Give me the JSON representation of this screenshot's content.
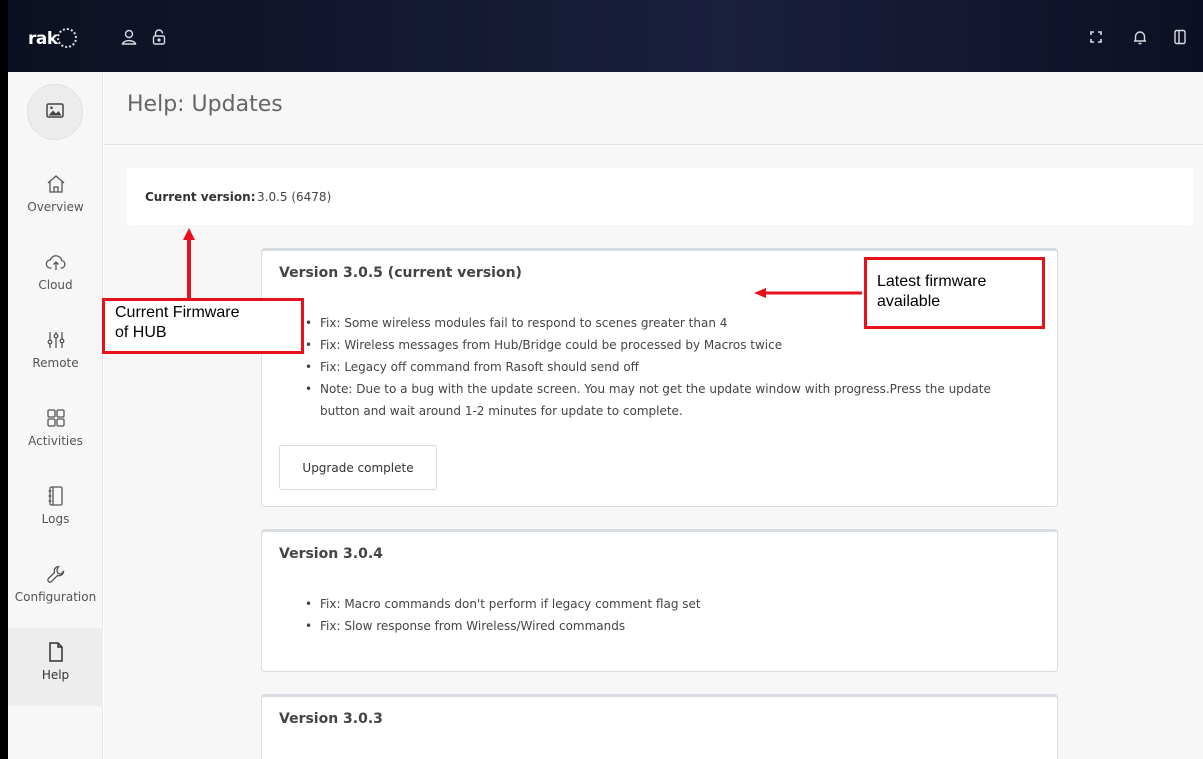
{
  "app": {
    "logo_text": "rak",
    "logo_mark": "gear-dots-logo"
  },
  "topbar": {
    "icons": [
      "user-icon",
      "lock-icon",
      "fullscreen-icon",
      "bell-icon",
      "sidebar-toggle-icon"
    ]
  },
  "sidebar": {
    "avatar_icon": "image-icon",
    "items": [
      {
        "label": "Overview",
        "icon": "home-icon"
      },
      {
        "label": "Cloud",
        "icon": "cloud-upload-icon"
      },
      {
        "label": "Remote",
        "icon": "sliders-icon"
      },
      {
        "label": "Activities",
        "icon": "grid-icon"
      },
      {
        "label": "Logs",
        "icon": "notebook-icon"
      },
      {
        "label": "Configuration",
        "icon": "wrench-icon"
      },
      {
        "label": "Help",
        "icon": "document-icon"
      }
    ],
    "active": "Help"
  },
  "header": {
    "title": "Help: Updates"
  },
  "current_version": {
    "label": "Current version:",
    "value": "3.0.5 (6478)"
  },
  "versions": [
    {
      "title": "Version 3.0.5 (current version)",
      "notes": [
        "Fix: Some wireless modules fail to respond to scenes greater than 4",
        "Fix: Wireless messages from Hub/Bridge could be processed by Macros twice",
        "Fix: Legacy off command from Rasoft should send off",
        "Note: Due to a bug with the update screen. You may not get the update window with progress.Press the update",
        "button and wait around 1-2 minutes for update to complete."
      ],
      "button_label": "Upgrade complete"
    },
    {
      "title": "Version 3.0.4",
      "notes": [
        "Fix: Macro commands don't perform if legacy comment flag set",
        "Fix: Slow response from Wireless/Wired commands"
      ]
    },
    {
      "title": "Version 3.0.3",
      "notes": []
    }
  ],
  "annotations": {
    "current_firmware": {
      "line1": "Current Firmware",
      "line2": "of HUB"
    },
    "latest_firmware": {
      "line1": "Latest firmware",
      "line2": "available"
    },
    "color": "#e8101b"
  }
}
